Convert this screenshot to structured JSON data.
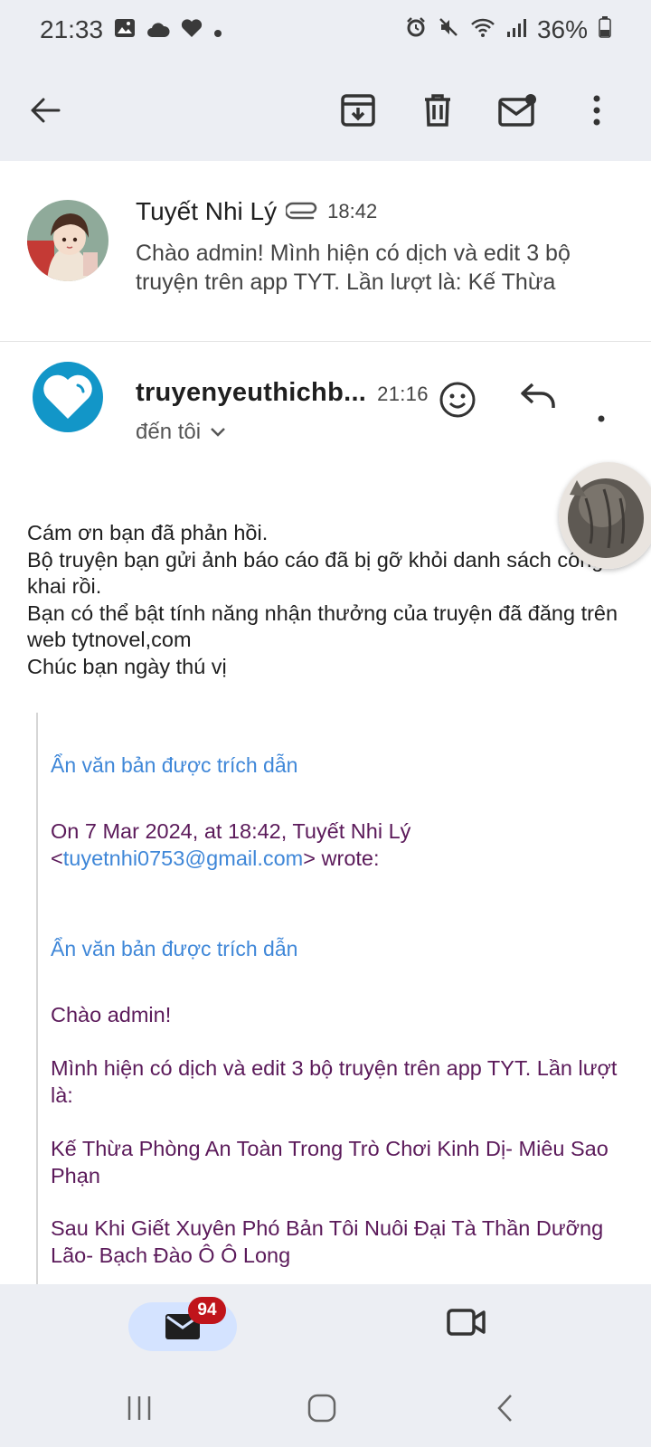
{
  "status_bar": {
    "time": "21:33",
    "battery": "36%",
    "left_icons": [
      "image-icon",
      "cloud-icon",
      "heart-icon",
      "dot-icon"
    ],
    "right_icons": [
      "alarm-icon",
      "mute-icon",
      "wifi-icon",
      "signal-icon",
      "battery-icon"
    ]
  },
  "toolbar": {
    "icons": [
      "back-arrow-icon",
      "archive-icon",
      "delete-icon",
      "mark-unread-icon",
      "more-vert-icon"
    ]
  },
  "message1": {
    "sender": "Tuyết Nhi Lý",
    "time": "18:42",
    "attachment_icon": "paperclip-icon",
    "snippet": "Chào admin! Mình hiện có dịch và edit 3 bộ truyện trên app TYT. Lần lượt là: Kế Thừa"
  },
  "message2": {
    "sender": "truyenyeuthichb...",
    "time": "21:16",
    "recipient_label": "đến tôi",
    "body_lines": [
      "Cám ơn bạn đã phản hồi.",
      "Bộ truyện bạn gửi ảnh báo cáo đã bị gỡ khỏi danh sách công khai rồi.",
      "Bạn có thể bật tính năng nhận thưởng của truyện đã đăng trên web tytnovel,com",
      "Chúc bạn ngày thú vị"
    ]
  },
  "quote": {
    "hide_quoted_1": "Ẩn văn bản được trích dẫn",
    "on_date_prefix": "On 7 Mar 2024, at 18:42, Tuyết Nhi Lý",
    "email_open": "<",
    "email": "tuyetnhi0753@gmail.com",
    "email_close": "> wrote:",
    "hide_quoted_2": "Ẩn văn bản được trích dẫn",
    "greeting": "Chào admin!",
    "intro": "Mình hiện có dịch và edit 3 bộ truyện trên app TYT. Lần lượt là:",
    "story1": "Kế Thừa Phòng An Toàn Trong Trò Chơi Kinh Dị- Miêu Sao Phạn",
    "story2": "Sau Khi Giết Xuyên Phó Bản Tôi Nuôi Đại Tà Thần Dưỡng Lão- Bạch Đào Ô Ô Long"
  },
  "bottom_nav": {
    "mail_badge": "94",
    "tabs": [
      "mail-icon",
      "video-icon"
    ]
  },
  "colors": {
    "brand_blue": "#1296c8",
    "link_blue": "#3f87d8",
    "quote_purple": "#5b1a5a",
    "badge_red": "#c0141b",
    "active_tab": "#d4e3ff"
  }
}
